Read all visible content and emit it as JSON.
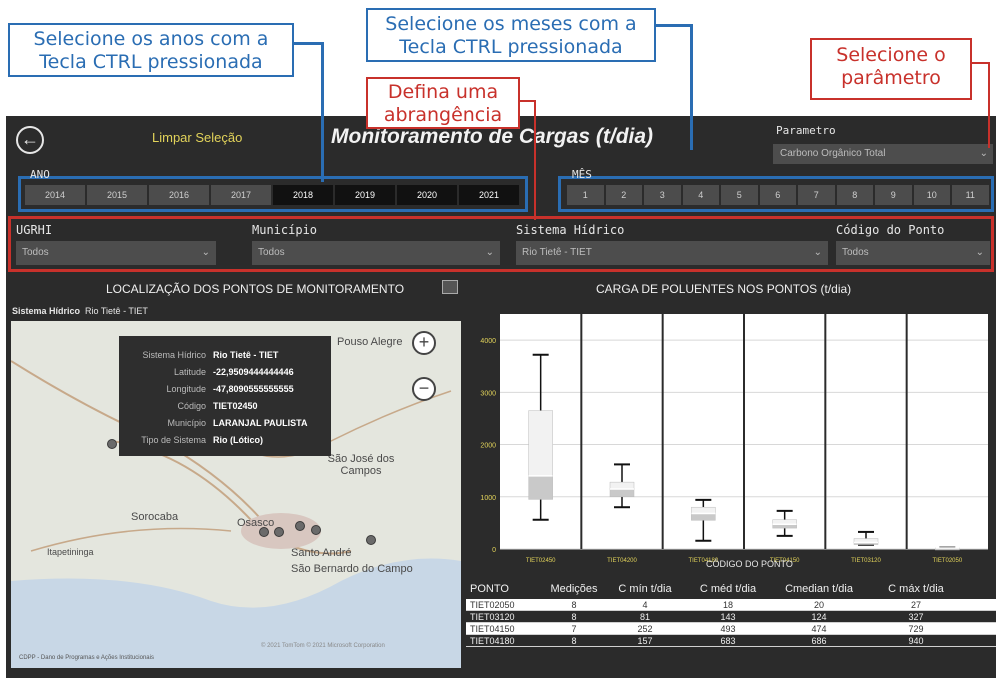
{
  "callouts": {
    "anos": "Selecione os anos com a Tecla CTRL pressionada",
    "meses": "Selecione os meses com a Tecla CTRL pressionada",
    "parametro": "Selecione o parâmetro",
    "abrangencia": "Defina uma abrangência"
  },
  "header": {
    "clear_label": "Limpar Seleção",
    "title": "Monitoramento de Cargas (t/dia)",
    "param_label": "Parametro",
    "param_value": "Carbono Orgânico Total"
  },
  "ano": {
    "label": "ANO",
    "years": [
      "2014",
      "2015",
      "2016",
      "2017",
      "2018",
      "2019",
      "2020",
      "2021"
    ],
    "selected": [
      "2018",
      "2019",
      "2020",
      "2021"
    ]
  },
  "mes": {
    "label": "MÊS",
    "months": [
      "1",
      "2",
      "3",
      "4",
      "5",
      "6",
      "7",
      "8",
      "9",
      "10",
      "11"
    ]
  },
  "filters": [
    {
      "label": "UGRHI",
      "value": "Todos"
    },
    {
      "label": "Município",
      "value": "Todos"
    },
    {
      "label": "Sistema Hídrico",
      "value": "Rio Tietê - TIET"
    },
    {
      "label": "Código do Ponto",
      "value": "Todos"
    }
  ],
  "map": {
    "title": "LOCALIZAÇÃO DOS PONTOS DE MONITORAMENTO",
    "filter_key": "Sistema Hídrico",
    "filter_value": "Rio Tietê - TIET",
    "footer": "CDPP - Dano de Programas e Ações Institucionais",
    "attribution": "© 2021 TomTom © 2021 Microsoft Corporation",
    "cities": [
      "Pouso Alegre",
      "São José dos Campos",
      "Sorocaba",
      "Osasco",
      "Santo André",
      "São Bernardo do Campo",
      "Itapetininga"
    ],
    "tooltip": [
      {
        "k": "Sistema Hídrico",
        "v": "Rio Tietê - TIET"
      },
      {
        "k": "Latitude",
        "v": "-22,9509444444446"
      },
      {
        "k": "Longitude",
        "v": "-47,8090555555555"
      },
      {
        "k": "Código",
        "v": "TIET02450"
      },
      {
        "k": "Município",
        "v": "LARANJAL PAULISTA"
      },
      {
        "k": "Tipo de Sistema",
        "v": "Rio (Lótico)"
      }
    ]
  },
  "chart_data": {
    "type": "box",
    "title": "CARGA DE POLUENTES NOS PONTOS (t/dia)",
    "xlabel": "CÓDIGO DO PONTO",
    "ylim": [
      0,
      4500
    ],
    "yticks": [
      "0",
      "1000",
      "2000",
      "3000",
      "4000"
    ],
    "categories": [
      "TIET02450",
      "TIET04200",
      "TIET04180",
      "TIET04150",
      "TIET03120",
      "TIET02050"
    ],
    "boxes": [
      {
        "min": 560,
        "q1": 950,
        "median": 1400,
        "q3": 2650,
        "max": 3720
      },
      {
        "min": 800,
        "q1": 1000,
        "median": 1150,
        "q3": 1280,
        "max": 1620
      },
      {
        "min": 157,
        "q1": 550,
        "median": 680,
        "q3": 800,
        "max": 940
      },
      {
        "min": 252,
        "q1": 400,
        "median": 474,
        "q3": 560,
        "max": 729
      },
      {
        "min": 81,
        "q1": 110,
        "median": 124,
        "q3": 200,
        "max": 327
      },
      {
        "min": 4,
        "q1": 10,
        "median": 20,
        "q3": 24,
        "max": 27
      }
    ]
  },
  "table": {
    "headers": [
      "PONTO",
      "Medições",
      "C mín t/dia",
      "C méd t/dia",
      "Cmedian t/dia",
      "C máx t/dia"
    ],
    "rows": [
      [
        "TIET02050",
        "8",
        "4",
        "18",
        "20",
        "27"
      ],
      [
        "TIET03120",
        "8",
        "81",
        "143",
        "124",
        "327"
      ],
      [
        "TIET04150",
        "7",
        "252",
        "493",
        "474",
        "729"
      ],
      [
        "TIET04180",
        "8",
        "157",
        "683",
        "686",
        "940"
      ]
    ]
  }
}
